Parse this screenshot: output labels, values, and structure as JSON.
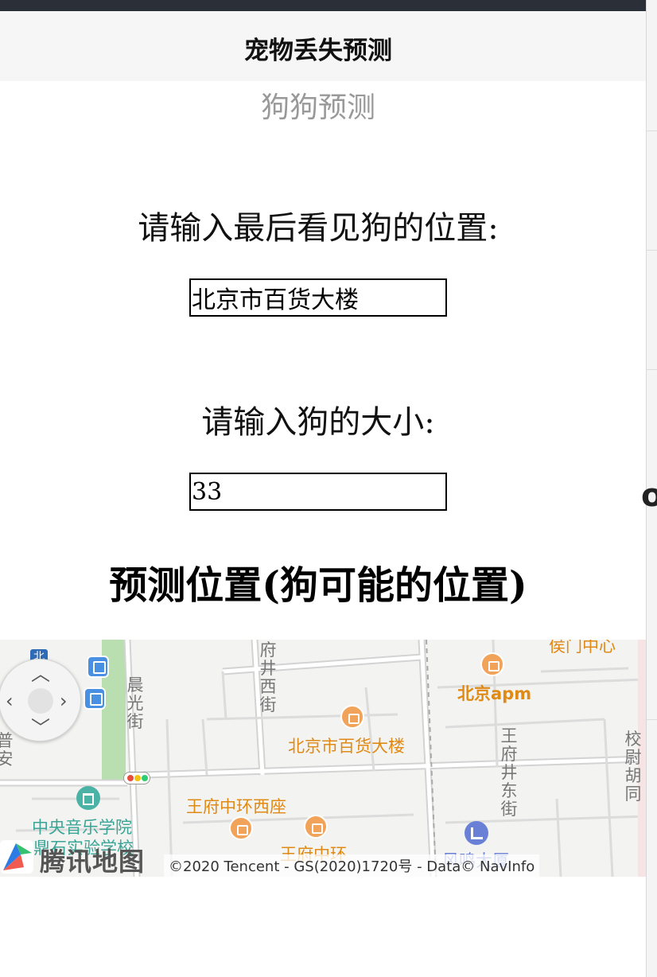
{
  "nav": {
    "title": "宠物丢失预测"
  },
  "page": {
    "subtitle": "狗狗预测",
    "location_label": "请输入最后看见狗的位置:",
    "location_value": "北京市百货大楼",
    "size_label": "请输入狗的大小:",
    "size_value": "33",
    "result_heading": "预测位置(狗可能的位置)"
  },
  "map": {
    "pois": {
      "department_store": "北京市百货大楼",
      "apm": "北京apm",
      "wangfu_west": "王府中环西座",
      "conservatory": "中央音乐学院",
      "school": "鼎石实验学校",
      "wangfu_center": "王府中环",
      "fengming": "风鸣大厦",
      "top_partial": "侯门中心"
    },
    "streets": {
      "chenguang": "晨光街",
      "wangfujing_west": "府井西街",
      "wangfujing_east": "王府井东街",
      "xiaowei": "校尉胡同",
      "left_partial": "普安"
    },
    "subway_label": "北",
    "logo_text": "腾讯地图",
    "copyright": "©2020 Tencent - GS(2020)1720号 - Data© NavInfo",
    "icons": [
      "compass-icon",
      "bus-stop-icon",
      "shopping-bag-icon",
      "school-icon",
      "office-building-icon",
      "traffic-light-icon",
      "subway-icon"
    ]
  },
  "edge": {
    "partial_glyph": "os"
  },
  "colors": {
    "poi": "#e08a16",
    "school": "#4bb3a6",
    "bus": "#4a90e2",
    "subtitle": "#999999",
    "statusbar": "#2b2f38"
  }
}
